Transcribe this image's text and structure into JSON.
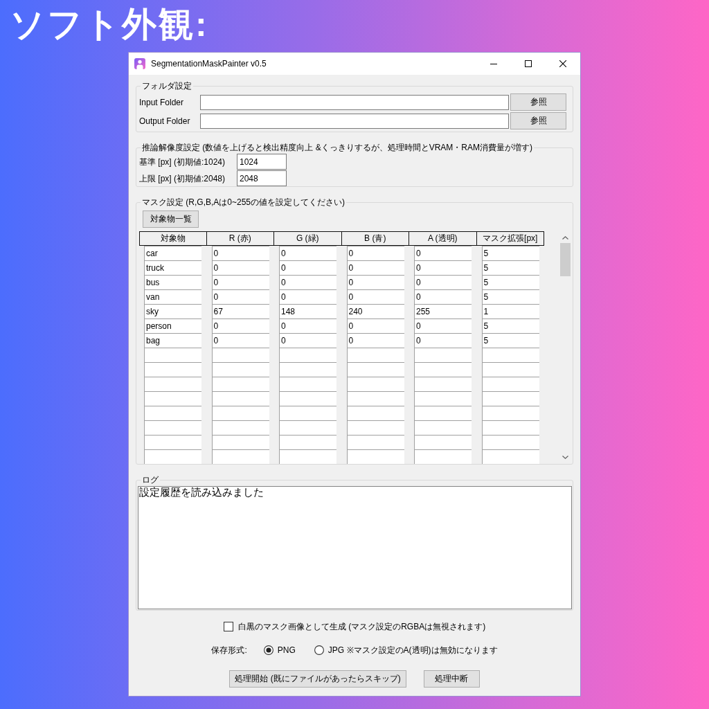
{
  "heading": "ソフト外観:",
  "window": {
    "title": "SegmentationMaskPainter v0.5"
  },
  "folder_settings": {
    "legend": "フォルダ設定",
    "rows": [
      {
        "label": "Input Folder",
        "button": "参照"
      },
      {
        "label": "Output Folder",
        "button": "参照"
      }
    ]
  },
  "resolution_settings": {
    "legend": "推論解像度設定 (数値を上げると検出精度向上 &くっきりするが、処理時間とVRAM・RAM消費量が増す)",
    "rows": [
      {
        "label": "基準 [px] (初期値:1024)",
        "value": "1024"
      },
      {
        "label": "上限 [px] (初期値:2048)",
        "value": "2048"
      }
    ]
  },
  "mask_settings": {
    "legend": "マスク設定 (R,G,B,Aは0~255の値を設定してください)",
    "list_button": "対象物一覧",
    "table": {
      "columns": [
        "対象物",
        "R (赤)",
        "G (緑)",
        "B (青)",
        "A (透明)",
        "マスク拡張[px]"
      ],
      "rows": [
        [
          "car",
          "0",
          "0",
          "0",
          "0",
          "5"
        ],
        [
          "truck",
          "0",
          "0",
          "0",
          "0",
          "5"
        ],
        [
          "bus",
          "0",
          "0",
          "0",
          "0",
          "5"
        ],
        [
          "van",
          "0",
          "0",
          "0",
          "0",
          "5"
        ],
        [
          "sky",
          "67",
          "148",
          "240",
          "255",
          "1"
        ],
        [
          "person",
          "0",
          "0",
          "0",
          "0",
          "5"
        ],
        [
          "bag",
          "0",
          "0",
          "0",
          "0",
          "5"
        ]
      ]
    }
  },
  "log": {
    "legend": "ログ",
    "text": "設定履歴を読み込みました"
  },
  "output_options": {
    "mono_mask": {
      "label": "白黒のマスク画像として生成 (マスク設定のRGBAは無視されます)",
      "checked": false
    },
    "format_label": "保存形式:",
    "formats": [
      {
        "label": "PNG",
        "selected": true
      },
      {
        "label": "JPG ※マスク設定のA(透明)は無効になります",
        "selected": false
      }
    ]
  },
  "buttons": [
    "処理開始 (既にファイルがあったらスキップ)",
    "処理中断"
  ]
}
